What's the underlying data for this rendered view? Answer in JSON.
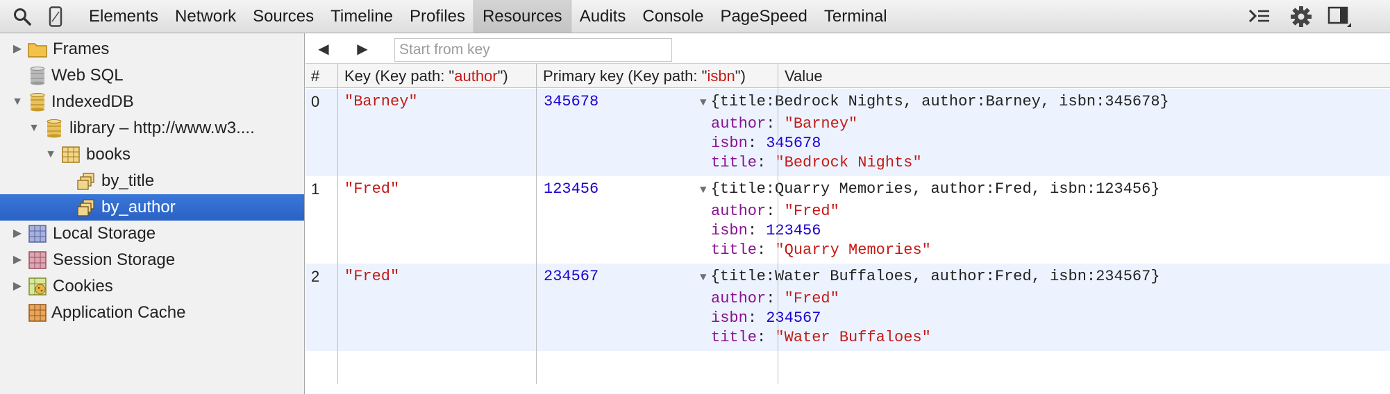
{
  "toolbar": {
    "tabs": [
      "Elements",
      "Network",
      "Sources",
      "Timeline",
      "Profiles",
      "Resources",
      "Audits",
      "Console",
      "PageSpeed",
      "Terminal"
    ],
    "active_tab": "Resources"
  },
  "sidebar": {
    "items": [
      {
        "label": "Frames"
      },
      {
        "label": "Web SQL"
      },
      {
        "label": "IndexedDB"
      },
      {
        "label": "library – http://www.w3...."
      },
      {
        "label": "books"
      },
      {
        "label": "by_title"
      },
      {
        "label": "by_author"
      },
      {
        "label": "Local Storage"
      },
      {
        "label": "Session Storage"
      },
      {
        "label": "Cookies"
      },
      {
        "label": "Application Cache"
      }
    ]
  },
  "main": {
    "search_placeholder": "Start from key",
    "search_value": "",
    "columns": {
      "num": "#",
      "key_prefix": "Key (Key path: \"",
      "key_path": "author",
      "key_suffix": "\")",
      "pk_prefix": "Primary key (Key path: \"",
      "pk_path": "isbn",
      "pk_suffix": "\")",
      "value": "Value"
    },
    "rows": [
      {
        "num": "0",
        "key": "\"Barney\"",
        "pk": "345678",
        "summary": "{title:Bedrock Nights, author:Barney, isbn:345678}",
        "props": [
          {
            "name": "author",
            "value": "\"Barney\"",
            "kind": "string"
          },
          {
            "name": "isbn",
            "value": "345678",
            "kind": "number"
          },
          {
            "name": "title",
            "value": "\"Bedrock Nights\"",
            "kind": "string"
          }
        ]
      },
      {
        "num": "1",
        "key": "\"Fred\"",
        "pk": "123456",
        "summary": "{title:Quarry Memories, author:Fred, isbn:123456}",
        "props": [
          {
            "name": "author",
            "value": "\"Fred\"",
            "kind": "string"
          },
          {
            "name": "isbn",
            "value": "123456",
            "kind": "number"
          },
          {
            "name": "title",
            "value": "\"Quarry Memories\"",
            "kind": "string"
          }
        ]
      },
      {
        "num": "2",
        "key": "\"Fred\"",
        "pk": "234567",
        "summary": "{title:Water Buffaloes, author:Fred, isbn:234567}",
        "props": [
          {
            "name": "author",
            "value": "\"Fred\"",
            "kind": "string"
          },
          {
            "name": "isbn",
            "value": "234567",
            "kind": "number"
          },
          {
            "name": "title",
            "value": "\"Water Buffaloes\"",
            "kind": "string"
          }
        ]
      }
    ]
  },
  "colors": {
    "string": "#c41a16",
    "number": "#1c00cf",
    "property": "#881391",
    "selection": "#2a62c4",
    "alt_row": "#ecf3fe"
  }
}
